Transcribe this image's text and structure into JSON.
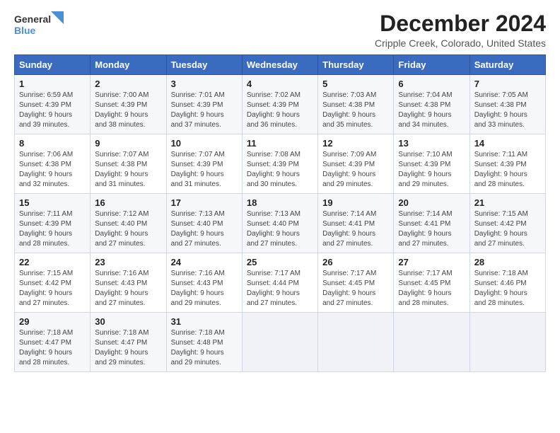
{
  "logo": {
    "line1": "General",
    "line2": "Blue"
  },
  "title": "December 2024",
  "location": "Cripple Creek, Colorado, United States",
  "weekdays": [
    "Sunday",
    "Monday",
    "Tuesday",
    "Wednesday",
    "Thursday",
    "Friday",
    "Saturday"
  ],
  "weeks": [
    [
      {
        "day": "1",
        "info": "Sunrise: 6:59 AM\nSunset: 4:39 PM\nDaylight: 9 hours\nand 39 minutes."
      },
      {
        "day": "2",
        "info": "Sunrise: 7:00 AM\nSunset: 4:39 PM\nDaylight: 9 hours\nand 38 minutes."
      },
      {
        "day": "3",
        "info": "Sunrise: 7:01 AM\nSunset: 4:39 PM\nDaylight: 9 hours\nand 37 minutes."
      },
      {
        "day": "4",
        "info": "Sunrise: 7:02 AM\nSunset: 4:39 PM\nDaylight: 9 hours\nand 36 minutes."
      },
      {
        "day": "5",
        "info": "Sunrise: 7:03 AM\nSunset: 4:38 PM\nDaylight: 9 hours\nand 35 minutes."
      },
      {
        "day": "6",
        "info": "Sunrise: 7:04 AM\nSunset: 4:38 PM\nDaylight: 9 hours\nand 34 minutes."
      },
      {
        "day": "7",
        "info": "Sunrise: 7:05 AM\nSunset: 4:38 PM\nDaylight: 9 hours\nand 33 minutes."
      }
    ],
    [
      {
        "day": "8",
        "info": "Sunrise: 7:06 AM\nSunset: 4:38 PM\nDaylight: 9 hours\nand 32 minutes."
      },
      {
        "day": "9",
        "info": "Sunrise: 7:07 AM\nSunset: 4:38 PM\nDaylight: 9 hours\nand 31 minutes."
      },
      {
        "day": "10",
        "info": "Sunrise: 7:07 AM\nSunset: 4:39 PM\nDaylight: 9 hours\nand 31 minutes."
      },
      {
        "day": "11",
        "info": "Sunrise: 7:08 AM\nSunset: 4:39 PM\nDaylight: 9 hours\nand 30 minutes."
      },
      {
        "day": "12",
        "info": "Sunrise: 7:09 AM\nSunset: 4:39 PM\nDaylight: 9 hours\nand 29 minutes."
      },
      {
        "day": "13",
        "info": "Sunrise: 7:10 AM\nSunset: 4:39 PM\nDaylight: 9 hours\nand 29 minutes."
      },
      {
        "day": "14",
        "info": "Sunrise: 7:11 AM\nSunset: 4:39 PM\nDaylight: 9 hours\nand 28 minutes."
      }
    ],
    [
      {
        "day": "15",
        "info": "Sunrise: 7:11 AM\nSunset: 4:39 PM\nDaylight: 9 hours\nand 28 minutes."
      },
      {
        "day": "16",
        "info": "Sunrise: 7:12 AM\nSunset: 4:40 PM\nDaylight: 9 hours\nand 27 minutes."
      },
      {
        "day": "17",
        "info": "Sunrise: 7:13 AM\nSunset: 4:40 PM\nDaylight: 9 hours\nand 27 minutes."
      },
      {
        "day": "18",
        "info": "Sunrise: 7:13 AM\nSunset: 4:40 PM\nDaylight: 9 hours\nand 27 minutes."
      },
      {
        "day": "19",
        "info": "Sunrise: 7:14 AM\nSunset: 4:41 PM\nDaylight: 9 hours\nand 27 minutes."
      },
      {
        "day": "20",
        "info": "Sunrise: 7:14 AM\nSunset: 4:41 PM\nDaylight: 9 hours\nand 27 minutes."
      },
      {
        "day": "21",
        "info": "Sunrise: 7:15 AM\nSunset: 4:42 PM\nDaylight: 9 hours\nand 27 minutes."
      }
    ],
    [
      {
        "day": "22",
        "info": "Sunrise: 7:15 AM\nSunset: 4:42 PM\nDaylight: 9 hours\nand 27 minutes."
      },
      {
        "day": "23",
        "info": "Sunrise: 7:16 AM\nSunset: 4:43 PM\nDaylight: 9 hours\nand 27 minutes."
      },
      {
        "day": "24",
        "info": "Sunrise: 7:16 AM\nSunset: 4:43 PM\nDaylight: 9 hours\nand 29 minutes."
      },
      {
        "day": "25",
        "info": "Sunrise: 7:17 AM\nSunset: 4:44 PM\nDaylight: 9 hours\nand 27 minutes."
      },
      {
        "day": "26",
        "info": "Sunrise: 7:17 AM\nSunset: 4:45 PM\nDaylight: 9 hours\nand 27 minutes."
      },
      {
        "day": "27",
        "info": "Sunrise: 7:17 AM\nSunset: 4:45 PM\nDaylight: 9 hours\nand 28 minutes."
      },
      {
        "day": "28",
        "info": "Sunrise: 7:18 AM\nSunset: 4:46 PM\nDaylight: 9 hours\nand 28 minutes."
      }
    ],
    [
      {
        "day": "29",
        "info": "Sunrise: 7:18 AM\nSunset: 4:47 PM\nDaylight: 9 hours\nand 28 minutes."
      },
      {
        "day": "30",
        "info": "Sunrise: 7:18 AM\nSunset: 4:47 PM\nDaylight: 9 hours\nand 29 minutes."
      },
      {
        "day": "31",
        "info": "Sunrise: 7:18 AM\nSunset: 4:48 PM\nDaylight: 9 hours\nand 29 minutes."
      },
      {
        "day": "",
        "info": ""
      },
      {
        "day": "",
        "info": ""
      },
      {
        "day": "",
        "info": ""
      },
      {
        "day": "",
        "info": ""
      }
    ]
  ]
}
